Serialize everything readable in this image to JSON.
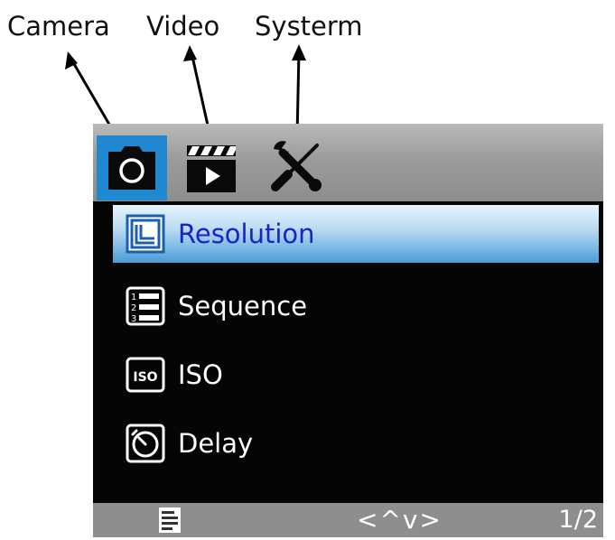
{
  "annotations": {
    "camera": "Camera",
    "video": "Video",
    "system": "Systerm"
  },
  "tabs": [
    {
      "name": "camera",
      "icon": "camera-icon",
      "selected": true
    },
    {
      "name": "video",
      "icon": "clapperboard-icon",
      "selected": false
    },
    {
      "name": "system",
      "icon": "wrench-screwdriver-icon",
      "selected": false
    }
  ],
  "menu": {
    "items": [
      {
        "label": "Resolution",
        "icon": "resolution-icon",
        "selected": true
      },
      {
        "label": "Sequence",
        "icon": "sequence-list-icon",
        "selected": false
      },
      {
        "label": "ISO",
        "icon": "iso-icon",
        "selected": false
      },
      {
        "label": "Delay",
        "icon": "timer-icon",
        "selected": false
      }
    ]
  },
  "footer": {
    "nav": "<^v>",
    "page": "1/2"
  },
  "colors": {
    "accent": "#1f88d0",
    "selected_text": "#1a22c8",
    "screen_bg": "#050505",
    "tabbar_bg": "#9c9c9c",
    "footer_bg": "#8e8e8e"
  }
}
